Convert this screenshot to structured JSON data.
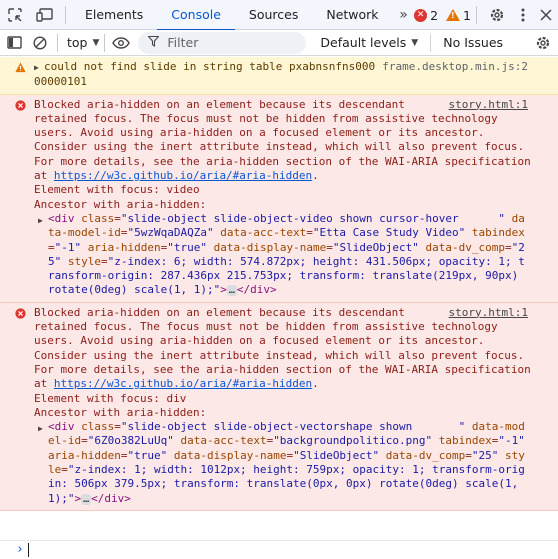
{
  "tabs": [
    {
      "label": "Elements"
    },
    {
      "label": "Console",
      "active": true
    },
    {
      "label": "Sources"
    },
    {
      "label": "Network"
    }
  ],
  "more_tabs_glyph": "»",
  "counts": {
    "errors": "2",
    "warnings": "1"
  },
  "toolbar": {
    "context": "top",
    "filter_placeholder": "Filter",
    "levels": "Default levels",
    "issues": "No Issues"
  },
  "colors": {
    "accent": "#0b57d0",
    "error_bg": "#fce8e6",
    "warning_bg": "#fef6d5",
    "error_icon": "#dc362e",
    "warning_icon": "#e37400"
  },
  "icons": [
    "inspect-element-icon",
    "device-toolbar-icon",
    "error-icon",
    "warning-icon",
    "settings-gear-icon",
    "more-options-icon",
    "close-icon",
    "sidebar-toggle-icon",
    "clear-console-icon",
    "eye-icon",
    "filter-icon"
  ],
  "messages": [
    {
      "level": "warning",
      "text": "could not find slide in string table pxabnsnfns00000000101",
      "source": "frame.desktop.min.js:2"
    },
    {
      "level": "error",
      "source": "story.html:1",
      "lines": [
        "Blocked aria-hidden on an element because its descendant",
        "retained focus. The focus must not be hidden from assistive technology",
        "users. Avoid using aria-hidden on a focused element or its ancestor.",
        "Consider using the inert attribute instead, which will also prevent focus.",
        "For more details, see the aria-hidden section of the WAI-ARIA specification"
      ],
      "at_prefix": "at ",
      "link": "https://w3c.github.io/aria/#aria-hidden",
      "link_suffix": ".",
      "focus_line": "Element with focus: video",
      "ancestor_line": "Ancestor with aria-hidden:",
      "element": {
        "tag_open": "<div",
        "class_name": "class",
        "class_value": "\"slide-object slide-object-video shown cursor-hover      \"",
        "model_name": "data-model-id",
        "model_value": "\"5wzWqaDAQZa\"",
        "acc_name": "data-acc-text",
        "acc_value": "\"Etta Case Study Video\"",
        "tabindex_name": "tabindex",
        "tabindex_value": "\"-1\"",
        "hidden_name": "aria-hidden",
        "hidden_value": "\"true\"",
        "display_name": "data-display-name",
        "display_value": "\"SlideObject\"",
        "comp_name": "data-dv_comp",
        "comp_value": "\"25\"",
        "style_name": "style",
        "style_value": "\"z-index: 6; width: 574.872px; height: 431.506px; opacity: 1; transform-origin: 287.436px 215.753px; transform: translate(219px, 90px) rotate(0deg) scale(1, 1);\"",
        "tag_close": "</div>"
      }
    },
    {
      "level": "error",
      "source": "story.html:1",
      "lines": [
        "Blocked aria-hidden on an element because its descendant",
        "retained focus. The focus must not be hidden from assistive technology",
        "users. Avoid using aria-hidden on a focused element or its ancestor.",
        "Consider using the inert attribute instead, which will also prevent focus.",
        "For more details, see the aria-hidden section of the WAI-ARIA specification"
      ],
      "at_prefix": "at ",
      "link": "https://w3c.github.io/aria/#aria-hidden",
      "link_suffix": ".",
      "focus_line": "Element with focus: div",
      "ancestor_line": "Ancestor with aria-hidden:",
      "element": {
        "tag_open": "<div",
        "class_name": "class",
        "class_value": "\"slide-object slide-object-vectorshape shown       \"",
        "model_name": "data-model-id",
        "model_value": "\"6Z0o382LuUq\"",
        "acc_name": "data-acc-text",
        "acc_value": "\"backgroundpolitico.png\"",
        "tabindex_name": "tabindex",
        "tabindex_value": "\"-1\"",
        "hidden_name": "aria-hidden",
        "hidden_value": "\"true\"",
        "display_name": "data-display-name",
        "display_value": "\"SlideObject\"",
        "comp_name": "data-dv_comp",
        "comp_value": "\"25\"",
        "style_name": "style",
        "style_value": "\"z-index: 1; width: 1012px; height: 759px; opacity: 1; transform-origin: 506px 379.5px; transform: translate(0px, 0px) rotate(0deg) scale(1, 1);\"",
        "tag_close": "</div>"
      }
    }
  ],
  "ellipsis": "…",
  "prompt_glyph": "›"
}
